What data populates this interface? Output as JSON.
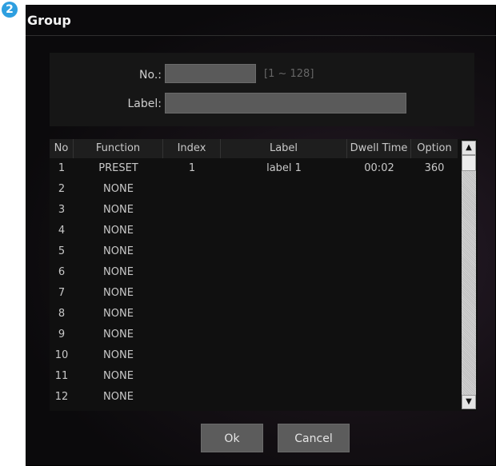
{
  "badge": "2",
  "dialog": {
    "title": "Group",
    "no_label": "No.:",
    "no_value": "",
    "no_range_hint": "[1 ~ 128]",
    "label_label": "Label:",
    "label_value": ""
  },
  "table": {
    "columns": [
      "No",
      "Function",
      "Index",
      "Label",
      "Dwell Time",
      "Option"
    ],
    "rows": [
      {
        "no": "1",
        "function": "PRESET",
        "index": "1",
        "label": "label 1",
        "dwell": "00:02",
        "option": "360"
      },
      {
        "no": "2",
        "function": "NONE",
        "index": "",
        "label": "",
        "dwell": "",
        "option": ""
      },
      {
        "no": "3",
        "function": "NONE",
        "index": "",
        "label": "",
        "dwell": "",
        "option": ""
      },
      {
        "no": "4",
        "function": "NONE",
        "index": "",
        "label": "",
        "dwell": "",
        "option": ""
      },
      {
        "no": "5",
        "function": "NONE",
        "index": "",
        "label": "",
        "dwell": "",
        "option": ""
      },
      {
        "no": "6",
        "function": "NONE",
        "index": "",
        "label": "",
        "dwell": "",
        "option": ""
      },
      {
        "no": "7",
        "function": "NONE",
        "index": "",
        "label": "",
        "dwell": "",
        "option": ""
      },
      {
        "no": "8",
        "function": "NONE",
        "index": "",
        "label": "",
        "dwell": "",
        "option": ""
      },
      {
        "no": "9",
        "function": "NONE",
        "index": "",
        "label": "",
        "dwell": "",
        "option": ""
      },
      {
        "no": "10",
        "function": "NONE",
        "index": "",
        "label": "",
        "dwell": "",
        "option": ""
      },
      {
        "no": "11",
        "function": "NONE",
        "index": "",
        "label": "",
        "dwell": "",
        "option": ""
      },
      {
        "no": "12",
        "function": "NONE",
        "index": "",
        "label": "",
        "dwell": "",
        "option": ""
      }
    ]
  },
  "buttons": {
    "ok": "Ok",
    "cancel": "Cancel"
  }
}
